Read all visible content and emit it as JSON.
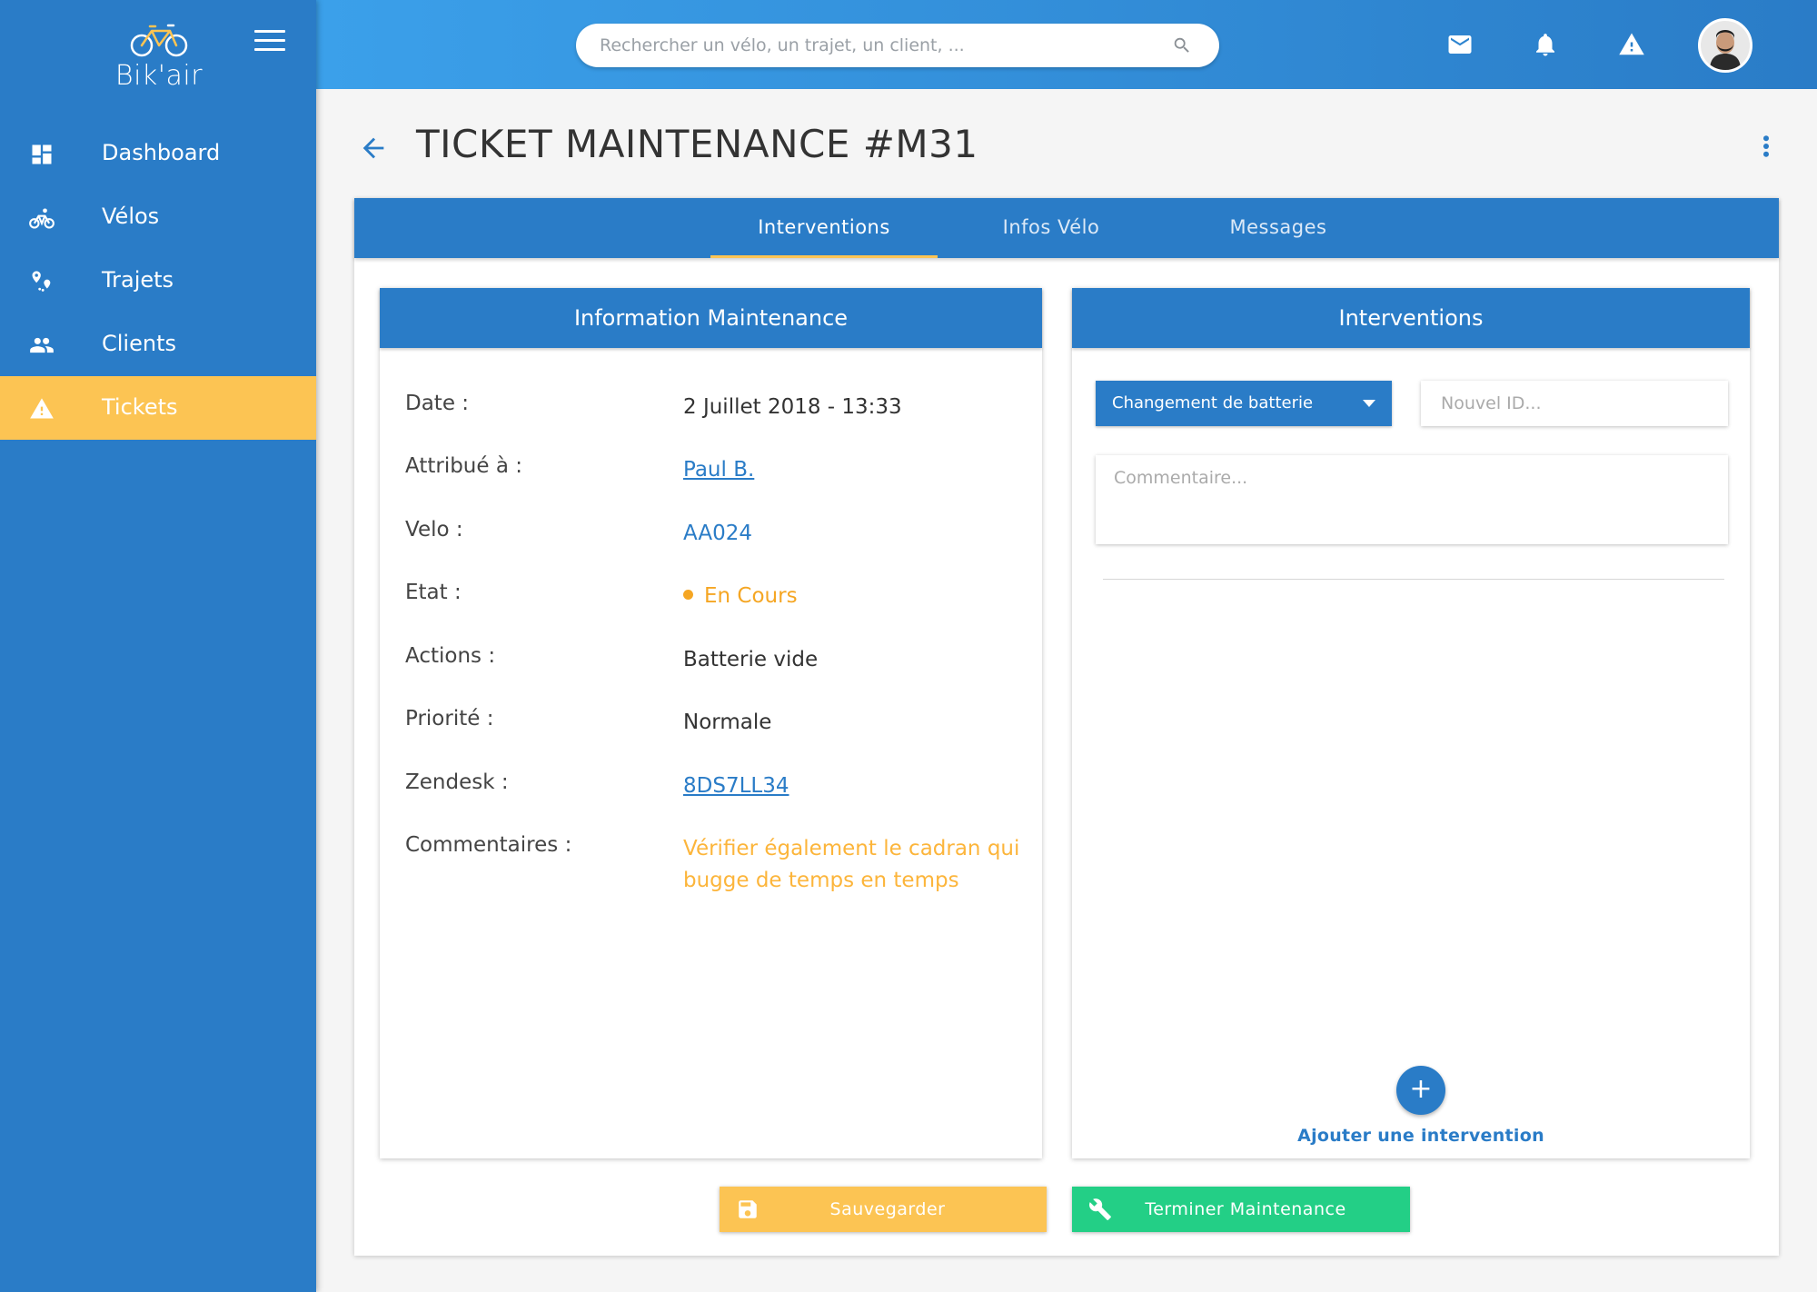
{
  "app": {
    "logo_text": "Bik'air"
  },
  "sidebar": {
    "items": [
      {
        "label": "Dashboard",
        "icon": "dashboard-icon"
      },
      {
        "label": "Vélos",
        "icon": "bike-icon"
      },
      {
        "label": "Trajets",
        "icon": "route-icon"
      },
      {
        "label": "Clients",
        "icon": "users-icon"
      },
      {
        "label": "Tickets",
        "icon": "warning-icon",
        "active": true
      }
    ]
  },
  "topbar": {
    "search_placeholder": "Rechercher un vélo, un trajet, un client, ..."
  },
  "header": {
    "title": "TICKET MAINTENANCE #M31"
  },
  "tabs": [
    {
      "label": "Interventions",
      "active": true
    },
    {
      "label": "Infos Vélo"
    },
    {
      "label": "Messages"
    }
  ],
  "info_panel": {
    "title": "Information Maintenance",
    "rows": {
      "date": {
        "label": "Date :",
        "value": "2 Juillet 2018 - 13:33"
      },
      "assigned": {
        "label": "Attribué à :",
        "value": "Paul B."
      },
      "bike": {
        "label": "Velo :",
        "value": "AA024"
      },
      "state": {
        "label": "Etat :",
        "value": "En Cours"
      },
      "actions": {
        "label": "Actions :",
        "value": "Batterie vide"
      },
      "priority": {
        "label": "Priorité :",
        "value": "Normale"
      },
      "zendesk": {
        "label": "Zendesk :",
        "value": "8DS7LL34"
      },
      "comments": {
        "label": "Commentaires :",
        "value": "Vérifier également le cadran qui bugge de temps en temps"
      }
    }
  },
  "interventions_panel": {
    "title": "Interventions",
    "select_value": "Changement de batterie",
    "id_placeholder": "Nouvel ID...",
    "comment_placeholder": "Commentaire...",
    "add_label": "Ajouter une intervention"
  },
  "actions": {
    "save_label": "Sauvegarder",
    "finish_label": "Terminer Maintenance"
  },
  "colors": {
    "primary": "#2a7cc7",
    "accent": "#fcc453",
    "success": "#23cf86",
    "status_in_progress": "#f5a623"
  }
}
